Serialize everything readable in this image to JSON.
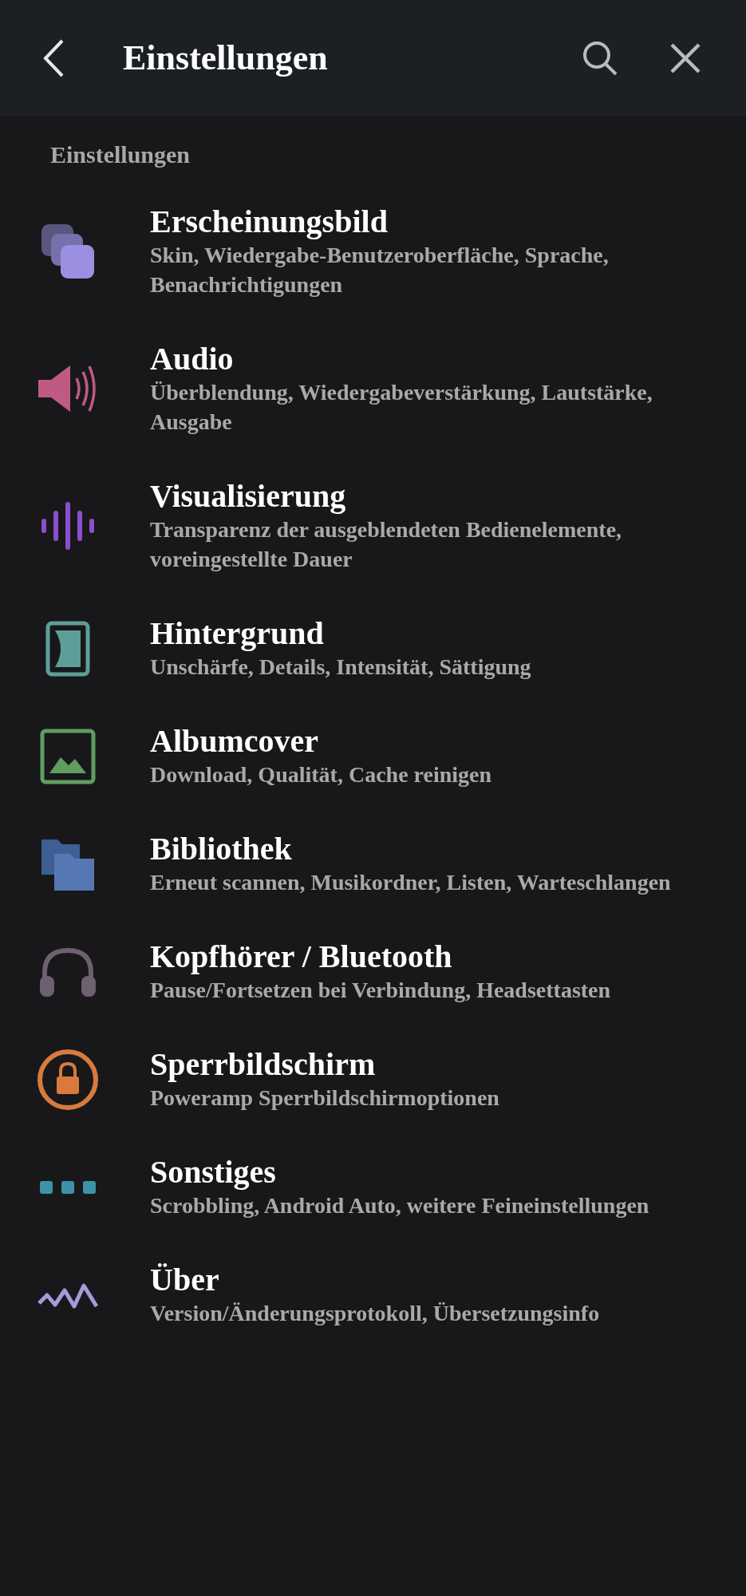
{
  "header": {
    "title": "Einstellungen"
  },
  "section_label": "Einstellungen",
  "items": [
    {
      "kind": "layers",
      "title": "Erscheinungsbild",
      "subtitle": "Skin, Wiedergabe-Benutzeroberfläche, Sprache, Benachrichtigungen"
    },
    {
      "kind": "speaker",
      "title": "Audio",
      "subtitle": "Überblendung, Wiedergabeverstärkung, Lautstärke, Ausgabe"
    },
    {
      "kind": "waveform",
      "title": "Visualisierung",
      "subtitle": "Transparenz der ausgeblendeten Bedienelemente, voreingestellte Dauer"
    },
    {
      "kind": "background",
      "title": "Hintergrund",
      "subtitle": "Unschärfe, Details, Intensität, Sättigung"
    },
    {
      "kind": "image",
      "title": "Albumcover",
      "subtitle": "Download, Qualität, Cache reinigen"
    },
    {
      "kind": "folders",
      "title": "Bibliothek",
      "subtitle": "Erneut scannen, Musikordner, Listen, Warteschlangen"
    },
    {
      "kind": "headphones",
      "title": "Kopfhörer / Bluetooth",
      "subtitle": "Pause/Fortsetzen bei Verbindung, Headsettasten"
    },
    {
      "kind": "lock",
      "title": "Sperrbildschirm",
      "subtitle": "Poweramp Sperrbildschirmoptionen"
    },
    {
      "kind": "dots",
      "title": "Sonstiges",
      "subtitle": "Scrobbling, Android Auto, weitere Feineinstellungen"
    },
    {
      "kind": "zigzag",
      "title": "Über",
      "subtitle": "Version/Änderungsprotokoll, Übersetzungsinfo"
    }
  ]
}
